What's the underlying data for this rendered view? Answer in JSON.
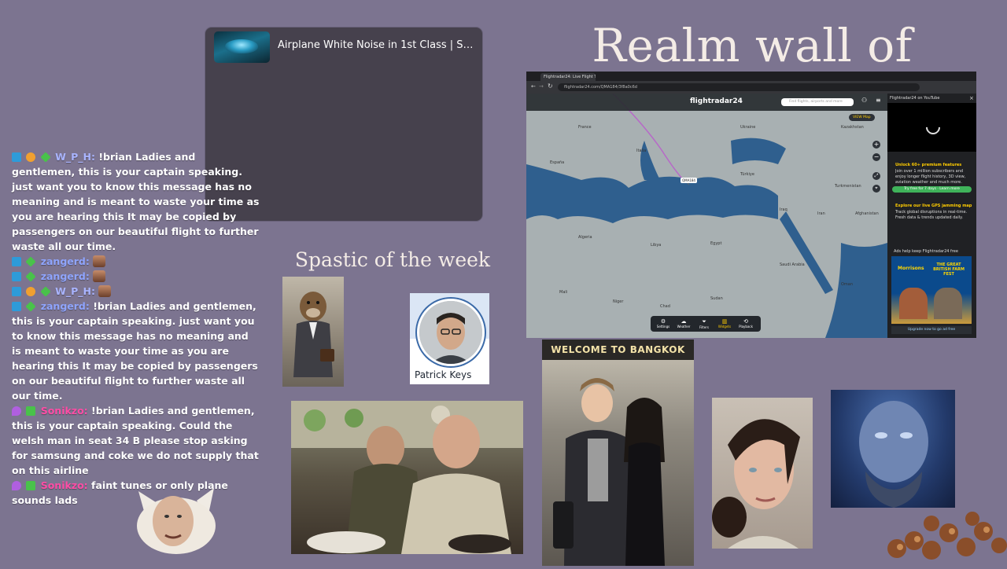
{
  "now_playing": {
    "title": "Airplane White Noise in 1st Class | Sle...",
    "thumbnail_icon": "airplane-thumbnail"
  },
  "headings": {
    "realm": "Realm wall of Art",
    "spastic": "Spastic of the week"
  },
  "chat": [
    {
      "name": "W_P_H:",
      "name_color": "#a9b4ff",
      "badges": [
        "blue",
        "orange",
        "green"
      ],
      "text": "!brian Ladies and gentlemen, this is your captain speaking. just want you to know this message has no meaning and is meant to waste your time as you are hearing this It may be copied by passengers on our beautiful flight to further waste all our time."
    },
    {
      "name": "zangerd:",
      "name_color": "#8fa5ff",
      "badges": [
        "blue",
        "green"
      ],
      "text": "",
      "emote": true
    },
    {
      "name": "zangerd:",
      "name_color": "#8fa5ff",
      "badges": [
        "blue",
        "green"
      ],
      "text": "",
      "emote": true
    },
    {
      "name": "W_P_H:",
      "name_color": "#a9b4ff",
      "badges": [
        "blue",
        "orange",
        "green"
      ],
      "text": "",
      "emote": true
    },
    {
      "name": "zangerd:",
      "name_color": "#8fa5ff",
      "badges": [
        "blue",
        "green"
      ],
      "text": "!brian Ladies and gentlemen, this is your captain speaking. just want you to know this message has no meaning and is meant to waste your time as you are hearing this It may be copied by passengers on our beautiful flight to further waste all our time."
    },
    {
      "name": "Sonikzo:",
      "name_color": "#ff4da6",
      "badges": [
        "purple",
        "green2"
      ],
      "text": "!brian Ladies and gentlemen, this is your captain speaking. Could the welsh man in seat 34 B please stop asking for samsung and coke we do not supply that on this airline"
    },
    {
      "name": "Sonikzo:",
      "name_color": "#ff4da6",
      "badges": [
        "purple",
        "green2"
      ],
      "text": "faint tunes or only plane sounds lads"
    }
  ],
  "profile": {
    "name": "Patrick Keys"
  },
  "bangkok": {
    "sign": "WELCOME TO BANGKOK"
  },
  "browser": {
    "tab_title": "Flightradar24: Live Flight Tracker",
    "url": "flightradar24.com/QMA184/3f8a0c6d",
    "logo": "flightradar24",
    "search_placeholder": "Find flights, airports and more",
    "flight_label": "QMA184",
    "view_label": "VIEW  Map",
    "sidebar_title": "Flightradar24 on YouTube",
    "premium_title": "Unlock 60+ premium features",
    "premium_text": "Join over 1 million subscribers and enjoy longer flight history, 3D view, aviation weather and much more.",
    "trial_button": "Try free for 7 days · Learn more",
    "gps_title": "Explore our live GPS jamming map",
    "gps_text": "Track global disruptions in real-time. Fresh data & trends updated daily.",
    "ads_text": "Ads help keep Flightradar24 free",
    "ad_headline": "THE GREAT BRITISH FARM FEST",
    "ad_brand": "Morrisons",
    "upgrade_button": "Upgrade now to go ad free",
    "bottom_controls": [
      "Settings",
      "Weather",
      "Filters",
      "Widgets",
      "Playback"
    ],
    "map_labels": [
      "France",
      "Italia",
      "España",
      "Algeria",
      "Libya",
      "Egypt",
      "Sudan",
      "Mali",
      "Niger",
      "Chad",
      "Türkiye",
      "Iraq",
      "Iran",
      "Saudi Arabia",
      "Oman",
      "Ukraine",
      "Kazakhstan",
      "Turkmenistan",
      "Afghanistan"
    ]
  },
  "colors": {
    "background": "#7c7490",
    "widget": "#46414d",
    "heading": "#f4ece6"
  }
}
